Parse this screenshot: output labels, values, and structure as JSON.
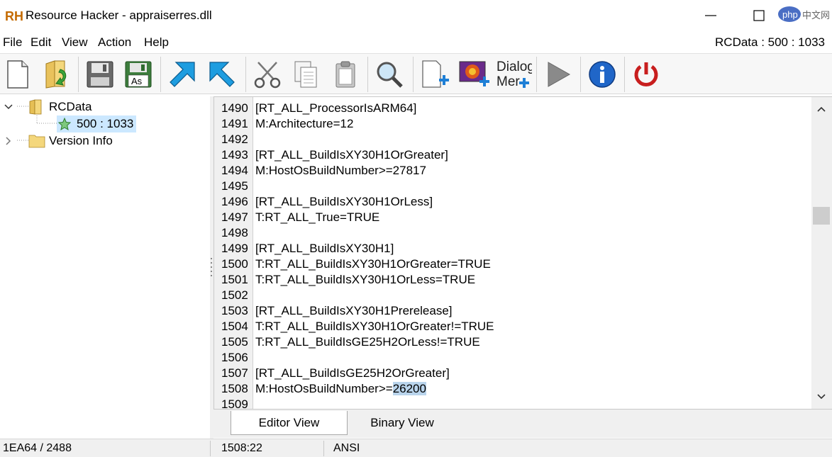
{
  "window": {
    "title": "Resource Hacker - appraiserres.dll",
    "logo": "RH",
    "watermark": "php 中文网",
    "min_icon": "minimize-icon",
    "max_icon": "maximize-icon"
  },
  "menu": {
    "items": [
      "File",
      "Edit",
      "View",
      "Action",
      "Help"
    ],
    "resource_id": "RCData : 500 : 1033"
  },
  "toolbar": {
    "icons": [
      "new-file-icon",
      "open-folder-icon",
      "save-icon",
      "save-as-icon",
      "compile-icon",
      "import-icon",
      "cut-icon",
      "copy-icon",
      "paste-icon",
      "find-icon",
      "add-resource-icon",
      "add-image-icon",
      "dialog-menu-icon",
      "run-icon",
      "info-icon",
      "exit-icon"
    ],
    "save_as_label": "As",
    "dialog_label": "Dialog",
    "menu_label": "Mer"
  },
  "tree": {
    "root": "RCData",
    "child": "500 : 1033",
    "other": "Version Info"
  },
  "editor": {
    "lines": [
      {
        "num": "1490",
        "text": "[RT_ALL_ProcessorIsARM64]"
      },
      {
        "num": "1491",
        "text": "M:Architecture=12"
      },
      {
        "num": "1492",
        "text": ""
      },
      {
        "num": "1493",
        "text": "[RT_ALL_BuildIsXY30H1OrGreater]"
      },
      {
        "num": "1494",
        "text": "M:HostOsBuildNumber>=27817"
      },
      {
        "num": "1495",
        "text": ""
      },
      {
        "num": "1496",
        "text": "[RT_ALL_BuildIsXY30H1OrLess]"
      },
      {
        "num": "1497",
        "text": "T:RT_ALL_True=TRUE"
      },
      {
        "num": "1498",
        "text": ""
      },
      {
        "num": "1499",
        "text": "[RT_ALL_BuildIsXY30H1]"
      },
      {
        "num": "1500",
        "text": "T:RT_ALL_BuildIsXY30H1OrGreater=TRUE"
      },
      {
        "num": "1501",
        "text": "T:RT_ALL_BuildIsXY30H1OrLess=TRUE"
      },
      {
        "num": "1502",
        "text": ""
      },
      {
        "num": "1503",
        "text": "[RT_ALL_BuildIsXY30H1Prerelease]"
      },
      {
        "num": "1504",
        "text": "T:RT_ALL_BuildIsXY30H1OrGreater!=TRUE"
      },
      {
        "num": "1505",
        "text": "T:RT_ALL_BuildIsGE25H2OrLess!=TRUE"
      },
      {
        "num": "1506",
        "text": ""
      },
      {
        "num": "1507",
        "text": "[RT_ALL_BuildIsGE25H2OrGreater]"
      },
      {
        "num": "1508",
        "text": "M:HostOsBuildNumber>=",
        "selected": "26200"
      },
      {
        "num": "1509",
        "text": ""
      }
    ]
  },
  "tabs": {
    "editor_view": "Editor View",
    "binary_view": "Binary View"
  },
  "status": {
    "offset": "1EA64 / 2488",
    "position": "1508:22",
    "encoding": "ANSI"
  }
}
